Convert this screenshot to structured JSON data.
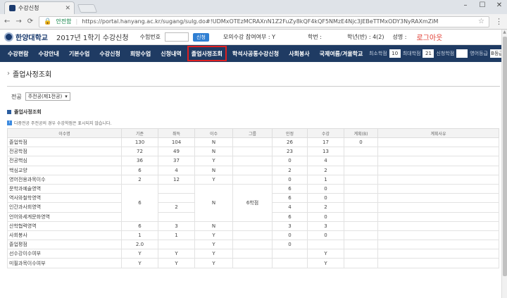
{
  "browser": {
    "tab_title": "수강신청",
    "secure_label": "안전함",
    "url": "https://portal.hanyang.ac.kr/sugang/sulg.do#!UDMxOTEzMCRAXnN1Z2FuZy8kQF4kQF5NMzE4Njc3JEBeTTMxODY3NyRAXmZiM"
  },
  "header": {
    "university": "한양대학교",
    "system_title": "2017년 1학기 수강신청",
    "exam_no_label": "수험번호",
    "search_btn": "신청",
    "mock_label": "모의수강 참여여부 : Y",
    "hakbun_label": "학번 :",
    "grade_label": "학년(반) : 4(2)",
    "name_label": "성명 :",
    "logout": "로그아웃"
  },
  "nav": {
    "items": [
      "수강편람",
      "수강안내",
      "기본수업",
      "수강신청",
      "희망수업",
      "신청내역",
      "졸업사정조회",
      "학석사공통수강신청",
      "사회봉사",
      "국제여름/겨울학교"
    ],
    "active_index": 6,
    "right": {
      "min_label": "최소학점",
      "min_val": "10",
      "max_label": "최대학점",
      "max_val": "21",
      "apply_label": "신청학점",
      "apply_val": "",
      "eng_label": "영어등급",
      "eng_val": "B등급"
    }
  },
  "page": {
    "title": "졸업사정조회",
    "filter_label": "전공",
    "filter_value": "주전공(제1전공)",
    "section_title": "졸업사정조회",
    "note": "다중전공 주전공의 경우 수강학점은 표시되지 않습니다."
  },
  "table": {
    "headers": [
      "이수명",
      "기준",
      "취득",
      "이수",
      "그룹",
      "인정",
      "수강",
      "계획(B)",
      "계획사유"
    ],
    "rows": [
      {
        "name": "졸업학점",
        "std": "130",
        "get": "104",
        "fin": "N",
        "grp": "",
        "rec": "26",
        "cur": "17",
        "plan": "0",
        "reason": ""
      },
      {
        "name": "전공학점",
        "std": "72",
        "get": "49",
        "fin": "N",
        "grp": "",
        "rec": "23",
        "cur": "13",
        "plan": "",
        "reason": ""
      },
      {
        "name": "전공핵심",
        "std": "36",
        "get": "37",
        "fin": "Y",
        "grp": "",
        "rec": "0",
        "cur": "4",
        "plan": "",
        "reason": ""
      },
      {
        "name": "핵심교양",
        "std": "6",
        "get": "4",
        "fin": "N",
        "grp": "",
        "rec": "2",
        "cur": "2",
        "plan": "",
        "reason": ""
      },
      {
        "name": "영어전용과목이수",
        "std": "2",
        "get": "12",
        "fin": "Y",
        "grp": "",
        "rec": "0",
        "cur": "1",
        "plan": "",
        "reason": ""
      },
      {
        "name": "문학과예술영역",
        "std": "",
        "get": "",
        "fin": "",
        "grp": "",
        "rec": "6",
        "cur": "0",
        "plan": "",
        "reason": ""
      },
      {
        "name": "역사와철학영역",
        "std": "",
        "get": "",
        "fin": "",
        "grp": "",
        "rec": "6",
        "cur": "0",
        "plan": "",
        "reason": ""
      },
      {
        "name": "인간과사회영역",
        "std": "",
        "get": "2",
        "fin": "",
        "grp": "",
        "rec": "4",
        "cur": "2",
        "plan": "",
        "reason": ""
      },
      {
        "name": "언어와세계문화영역",
        "std": "",
        "get": "",
        "fin": "",
        "grp": "",
        "rec": "6",
        "cur": "0",
        "plan": "",
        "reason": ""
      },
      {
        "name": "산학협력영역",
        "std": "6",
        "get": "3",
        "fin": "N",
        "grp": "",
        "rec": "3",
        "cur": "3",
        "plan": "",
        "reason": ""
      },
      {
        "name": "사회봉사",
        "std": "1",
        "get": "1",
        "fin": "Y",
        "grp": "",
        "rec": "0",
        "cur": "0",
        "plan": "",
        "reason": ""
      },
      {
        "name": "졸업평점",
        "std": "2.0",
        "get": "",
        "fin": "Y",
        "grp": "",
        "rec": "0",
        "cur": "",
        "plan": "",
        "reason": ""
      },
      {
        "name": "선수강이수여부",
        "std": "Y",
        "get": "Y",
        "fin": "Y",
        "grp": "",
        "rec": "",
        "cur": "Y",
        "plan": "",
        "reason": ""
      },
      {
        "name": "미필과목이수여부",
        "std": "Y",
        "get": "Y",
        "fin": "Y",
        "grp": "",
        "rec": "",
        "cur": "Y",
        "plan": "",
        "reason": ""
      }
    ],
    "merged": {
      "std": "6",
      "fin": "N",
      "grp": "6학점"
    }
  }
}
